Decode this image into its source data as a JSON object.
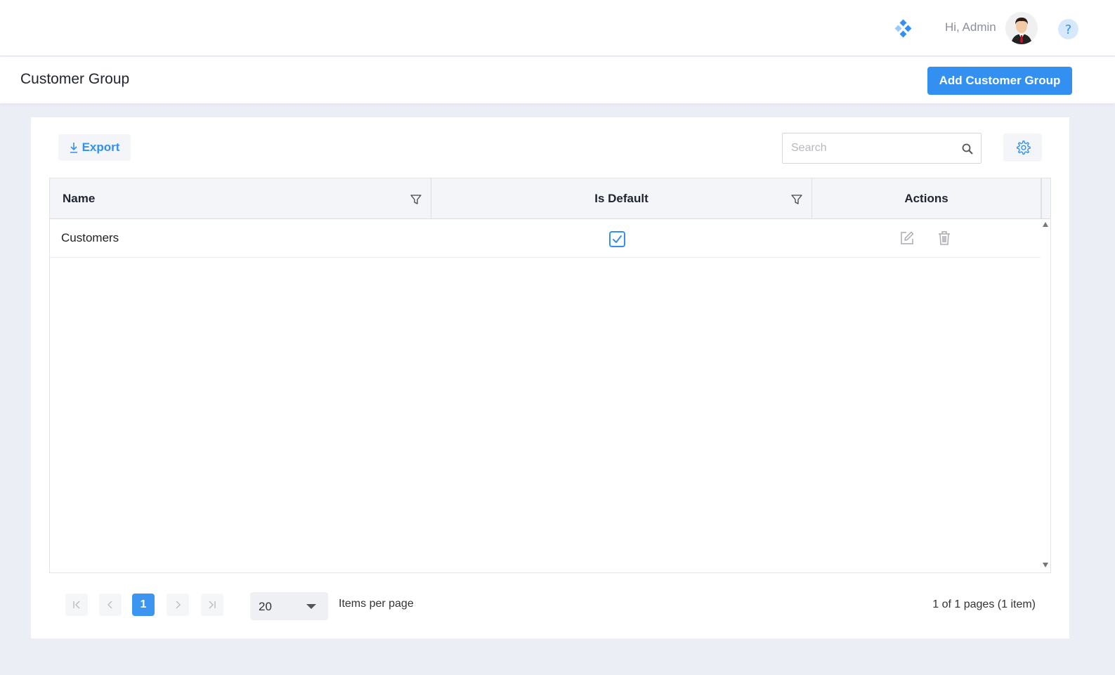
{
  "header": {
    "greeting": "Hi, Admin",
    "icons": [
      "apps-icon",
      "avatar",
      "help-icon"
    ]
  },
  "page": {
    "title": "Customer Group",
    "add_button_label": "Add Customer Group"
  },
  "toolbar": {
    "export_label": "Export",
    "search_placeholder": "Search",
    "search_value": ""
  },
  "grid": {
    "columns": [
      "Name",
      "Is Default",
      "Actions"
    ],
    "rows": [
      {
        "name": "Customers",
        "is_default": true
      }
    ]
  },
  "pager": {
    "first": "K",
    "prev": "<",
    "current_page": "1",
    "next": ">",
    "last": ">I",
    "page_size": "20",
    "items_per_page_label": "Items per page",
    "info": "1 of 1 pages (1 item)"
  },
  "colors": {
    "accent": "#3390f0",
    "background": "#eceef5",
    "header_bg": "#f3f5f8"
  }
}
